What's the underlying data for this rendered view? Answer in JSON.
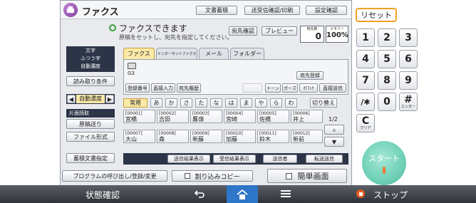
{
  "header": {
    "app_title": "ファクス",
    "buttons": [
      "文書蓄積",
      "送受信確認/印刷",
      "設定確認"
    ]
  },
  "status": {
    "message": "ファクスできます",
    "hint": "原稿をセットし、宛先を指定してください。",
    "dest_check_button": "宛先確認",
    "preview_button": "プレビュー",
    "dest_count_label": "宛先数",
    "dest_count": "0",
    "memory_label": "メモリー",
    "memory_value": "100%"
  },
  "left_panel": {
    "quality_lines": [
      "文字",
      "ふつう字",
      "自動濃度"
    ],
    "scan_settings": "読み取り条件",
    "density_label": "自動濃度",
    "mode_label": "片面読取",
    "send_mode": "原稿送り",
    "file_type": "ファイル形式",
    "stored_file": "蓄積文書指定"
  },
  "tabs": [
    "ファクス",
    "インターネットファクス",
    "メール",
    "フォルダー"
  ],
  "input_area": {
    "g3_label": "G3",
    "register_button": "宛先登録",
    "buttons": [
      "登録番号",
      "直接入力",
      "宛先履歴"
    ],
    "right_buttons": [
      "トーン",
      "ポーズ",
      "ｵﾌﾌｯｸ",
      "直接送信"
    ]
  },
  "index": {
    "keys": [
      "常用",
      "あ",
      "か",
      "さ",
      "た",
      "な",
      "は",
      "ま",
      "や",
      "ら",
      "わ"
    ],
    "switch_button": "切り替え"
  },
  "destinations": [
    {
      "code": "[00001]",
      "name": "宮橋"
    },
    {
      "code": "[00002]",
      "name": "吉田"
    },
    {
      "code": "[00003]",
      "name": "鷹嶺"
    },
    {
      "code": "[00004]",
      "name": "宮崎"
    },
    {
      "code": "[00005]",
      "name": "佐橋"
    },
    {
      "code": "[00006]",
      "name": "井上"
    },
    {
      "code": "[00007]",
      "name": "大山"
    },
    {
      "code": "[00008]",
      "name": "森"
    },
    {
      "code": "[00009]",
      "name": "新藤"
    },
    {
      "code": "[00010]",
      "name": "加藤"
    },
    {
      "code": "[00011]",
      "name": "鈴木"
    },
    {
      "code": "[00012]",
      "name": "新前"
    }
  ],
  "pagination": {
    "page": "1/2"
  },
  "bottom_buttons": [
    "送信結果表示",
    "受信結果表示",
    "送信者",
    "転送送信"
  ],
  "program_bar": {
    "program_button": "プログラムの呼び出し/登録/変更",
    "interrupt_copy": "割り込みコピー",
    "simple_screen": "簡単画面"
  },
  "keypad": {
    "reset": "リセット",
    "keys": [
      "1",
      "2",
      "3",
      "4",
      "5",
      "6",
      "7",
      "8",
      "9",
      "/✱",
      "0",
      "#"
    ],
    "hash_sub": "エンター",
    "clear": "C",
    "clear_sub": "クリア",
    "start": "スタート"
  },
  "statusbar": {
    "status_check": "状態確認",
    "stop": "ストップ"
  },
  "colors": {
    "accent": "#f0a020",
    "start": "#6fd0b6",
    "active_tab": "#fbe9a8"
  }
}
